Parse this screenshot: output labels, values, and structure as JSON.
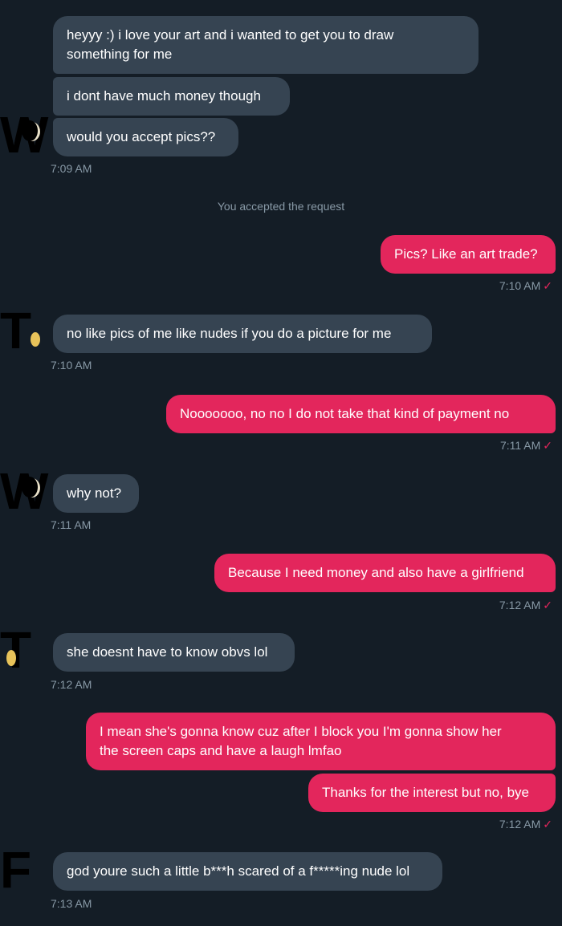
{
  "conversation": {
    "messages": [
      {
        "text": "heyyy :) i love your art and i wanted to get you to draw\nsomething for me"
      },
      {
        "text": "i dont have much money though"
      },
      {
        "text": "would you accept pics??"
      },
      {
        "time": "7:09 AM"
      },
      {
        "system": "You accepted the request"
      },
      {
        "text": "Pics? Like an art trade?"
      },
      {
        "time": "7:10 AM"
      },
      {
        "text": "no like pics of me like nudes if you do a picture for me"
      },
      {
        "time": "7:10 AM"
      },
      {
        "text": "Nooooooo, no no I do not take that kind of payment no"
      },
      {
        "time": "7:11 AM"
      },
      {
        "text": "why not?"
      },
      {
        "time": "7:11 AM"
      },
      {
        "text": "Because I need money and also have a girlfriend"
      },
      {
        "time": "7:12 AM"
      },
      {
        "text": "she doesnt have to know obvs lol"
      },
      {
        "time": "7:12 AM"
      },
      {
        "text": "I mean she's gonna know cuz after I block you I'm gonna show her\nthe screen caps and have a laugh lmfao"
      },
      {
        "text": "Thanks for the interest but no, bye"
      },
      {
        "time": "7:12 AM"
      },
      {
        "text": "god youre such a little b***h scared of a f*****ing nude lol"
      },
      {
        "time": "7:13 AM"
      }
    ],
    "read_check": "✓",
    "avatars": [
      "W",
      "T",
      "W",
      "T",
      "F"
    ]
  },
  "colors": {
    "background": "#141d26",
    "incoming_bubble": "#364452",
    "outgoing_bubble": "#e3265c",
    "timestamp": "#8899a6"
  }
}
